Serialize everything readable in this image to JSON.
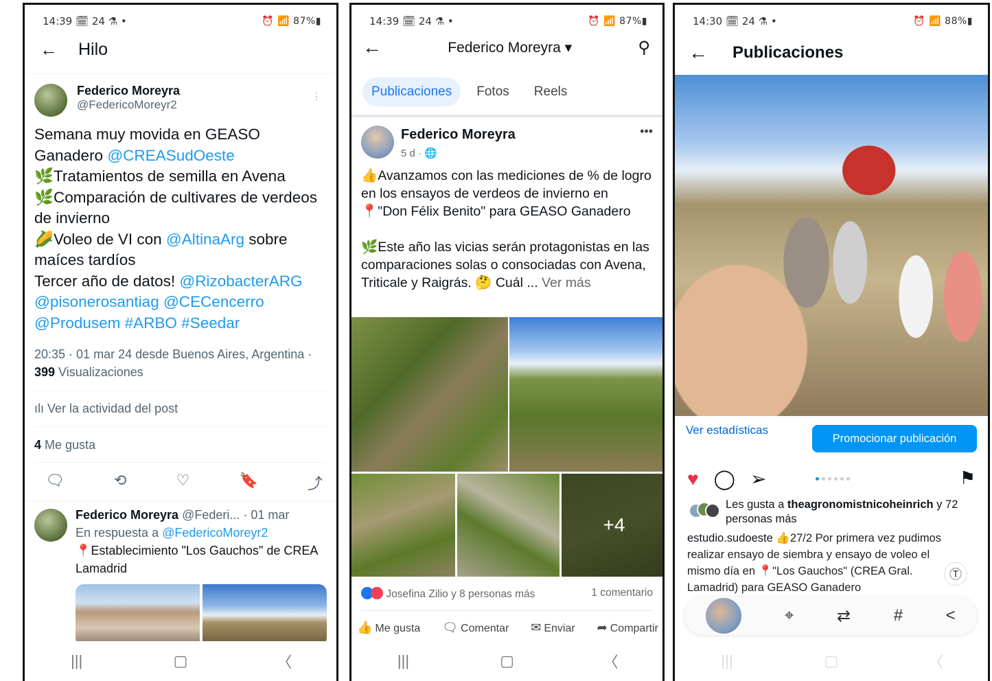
{
  "twitter": {
    "status": {
      "time": "14:39",
      "left_icons": "🗓 24 ⚗ •",
      "right": "87%"
    },
    "header": {
      "title": "Hilo"
    },
    "author": {
      "name": "Federico Moreyra",
      "handle": "@FedericoMoreyr2"
    },
    "tweet": {
      "line1": "Semana muy movida en GEASO",
      "line2a": "Ganadero ",
      "mention1": "@CREASudOeste",
      "line3": "🌿Tratamientos de semilla en Avena",
      "line4": "🌿Comparación de cultivares de verdeos de invierno",
      "line5a": "🌽Voleo de VI con ",
      "mention2": "@AltinaArg",
      "line5b": " sobre maíces tardíos",
      "line6a": "Tercer año de datos! ",
      "mention3": "@RizobacterARG",
      "mentions4": "@pisonerosantiag @CECencerro @Produsem #ARBO #Seedar"
    },
    "meta": {
      "time": "20:35 · 01 mar 24 desde Buenos Aires, Argentina · ",
      "views_count": "399",
      "views_label": " Visualizaciones"
    },
    "activity": "Ver la actividad del post",
    "likes": {
      "count": "4",
      "label": " Me gusta"
    },
    "reply": {
      "name": "Federico Moreyra",
      "handle": "@Federi...",
      "date": "· 01 mar",
      "in_reply": "En respuesta a ",
      "in_reply_handle": "@FedericoMoreyr2",
      "text": "📍Establecimiento \"Los Gauchos\" de CREA Lamadrid"
    }
  },
  "facebook": {
    "status": {
      "time": "14:39",
      "left_icons": "🗓 24 ⚗ •",
      "right": "87%"
    },
    "header": {
      "title": "Federico Moreyra ▾"
    },
    "tabs": [
      "Publicaciones",
      "Fotos",
      "Reels"
    ],
    "post": {
      "name": "Federico Moreyra",
      "time": "5 d · 🌐",
      "p1": "👍Avanzamos con las mediciones de % de logro en los ensayos de verdeos de invierno en 📍\"Don Félix Benito\" para GEASO Ganadero",
      "p2": "🌿Este año las vicias serán protagonistas en las comparaciones solas o consociadas con Avena, Triticale y Raigrás. 🤔 Cuál ... ",
      "see_more": "Ver más",
      "more_photos": "+4",
      "reactions": "Josefina Zilio y 8 personas más",
      "comments": "1 comentario",
      "actions": [
        "Me gusta",
        "Comentar",
        "Enviar",
        "Compartir"
      ]
    }
  },
  "instagram": {
    "status": {
      "time": "14:30",
      "left_icons": "🗓 24 ⚗ •",
      "right": "88%"
    },
    "header": {
      "title": "Publicaciones"
    },
    "stats": "Ver estadísticas",
    "promote": "Promocionar publicación",
    "liked_by": "Les gusta a ",
    "liked_user": "theagronomistnicoheinrich",
    "liked_rest": " y 72 personas más",
    "caption_user": "estudio.sudoeste",
    "caption": " 👍27/2 Por primera vez pudimos realizar ensayo de siembra y ensayo de voleo el mismo día en 📍\"Los Gauchos\" (CREA Gral. Lamadrid) para GEASO Ganadero"
  }
}
